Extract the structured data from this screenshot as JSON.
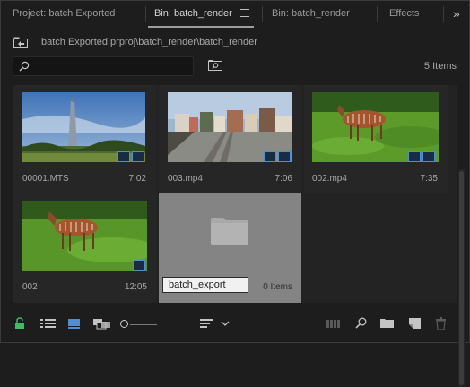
{
  "tabs": [
    {
      "label": "Project: batch Exported",
      "active": false
    },
    {
      "label": "Bin: batch_render",
      "active": true
    },
    {
      "label": "Bin: batch_render",
      "active": false
    },
    {
      "label": "Effects",
      "active": false
    }
  ],
  "path": "batch Exported.prproj\\batch_render\\batch_render",
  "search": {
    "value": "",
    "placeholder": ""
  },
  "item_count": "5 Items",
  "items": [
    {
      "name": "00001.MTS",
      "duration": "7:02",
      "icon": "video-clip-badge-icon"
    },
    {
      "name": "003.mp4",
      "duration": "7:06",
      "icon": "video-clip-badge-icon"
    },
    {
      "name": "002.mp4",
      "duration": "7:35",
      "icon": "video-clip-badge-icon"
    },
    {
      "name": "002",
      "duration": "12:05",
      "icon": "sequence-badge-icon"
    }
  ],
  "new_bin": {
    "name_value": "batch_export",
    "count": "0 Items"
  },
  "colors": {
    "accent": "#4c8fd6",
    "lock": "#3dbb5f",
    "selected_bg": "#848484",
    "panel_bg": "#1d1d1d"
  }
}
